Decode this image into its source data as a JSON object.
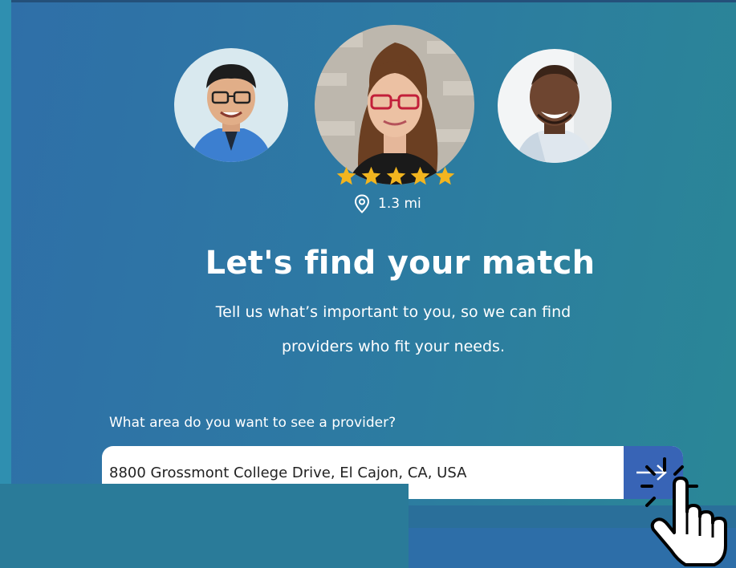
{
  "providers": [
    {
      "name": "provider-left"
    },
    {
      "name": "provider-featured"
    },
    {
      "name": "provider-right"
    }
  ],
  "featured": {
    "rating": 5,
    "distance": "1.3 mi"
  },
  "hero": {
    "title": "Let's find your match",
    "subtitle_line1": "Tell us what’s important to you, so we can find",
    "subtitle_line2": "providers who fit your needs."
  },
  "search": {
    "label": "What area do you want to see a provider?",
    "value": "8800 Grossmont College Drive, El Cajon, CA, USA"
  },
  "colors": {
    "star": "#f2b51f",
    "button": "#3864b6"
  },
  "icons": {
    "distance": "map-pin-icon",
    "submit": "arrow-right-icon",
    "cursor": "hand-pointer-icon"
  }
}
